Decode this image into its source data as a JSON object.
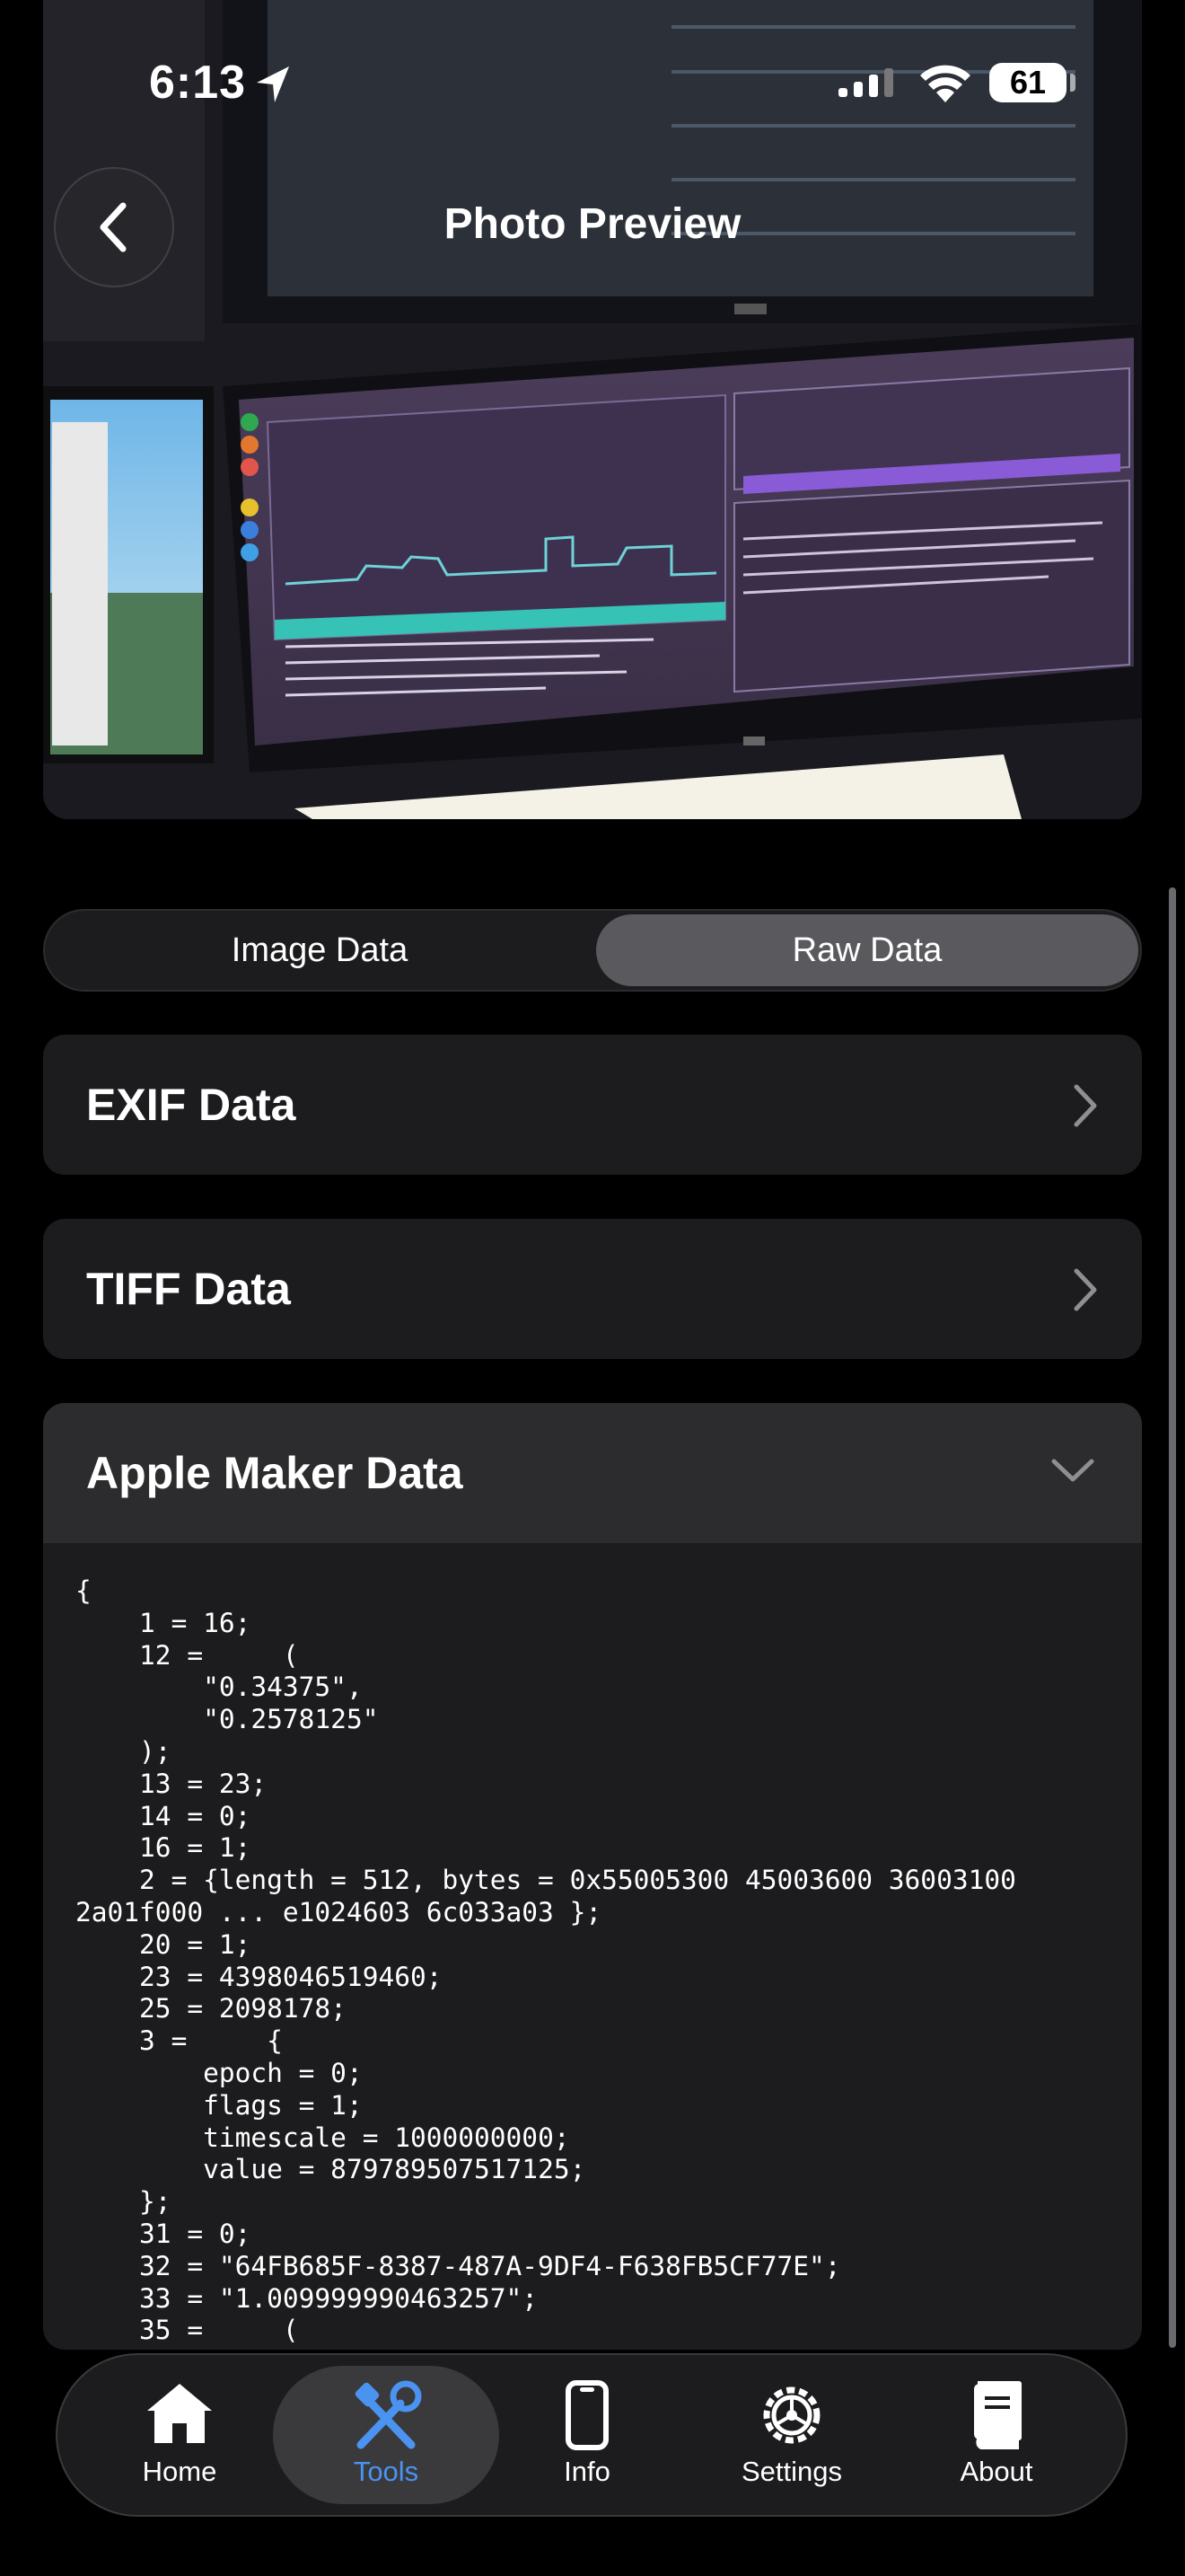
{
  "status_bar": {
    "time": "6:13",
    "battery": "61"
  },
  "header": {
    "title": "Photo Preview"
  },
  "segmented": {
    "left": "Image Data",
    "right": "Raw Data",
    "selected": "Raw Data"
  },
  "sections": [
    {
      "title": "EXIF Data",
      "expanded": false
    },
    {
      "title": "TIFF Data",
      "expanded": false
    },
    {
      "title": "Apple Maker Data",
      "expanded": true
    }
  ],
  "apple_maker_raw": "{\n    1 = 16;\n    12 =     (\n        \"0.34375\",\n        \"0.2578125\"\n    );\n    13 = 23;\n    14 = 0;\n    16 = 1;\n    2 = {length = 512, bytes = 0x55005300 45003600 36003100\n2a01f000 ... e1024603 6c033a03 };\n    20 = 1;\n    23 = 4398046519460;\n    25 = 2098178;\n    3 =     {\n        epoch = 0;\n        flags = 1;\n        timescale = 1000000000;\n        value = 879789507517125;\n    };\n    31 = 0;\n    32 = \"64FB685F-8387-487A-9DF4-F638FB5CF77E\";\n    33 = \"1.009999990463257\";\n    35 =     (",
  "tabs": [
    {
      "label": "Home",
      "icon": "house-icon"
    },
    {
      "label": "Tools",
      "icon": "tools-icon",
      "active": true
    },
    {
      "label": "Info",
      "icon": "phone-icon"
    },
    {
      "label": "Settings",
      "icon": "gear-icon"
    },
    {
      "label": "About",
      "icon": "book-icon"
    }
  ],
  "colors": {
    "accent": "#4a93f0",
    "card": "#1c1c1e",
    "segment_selected": "#5a5a5e"
  }
}
